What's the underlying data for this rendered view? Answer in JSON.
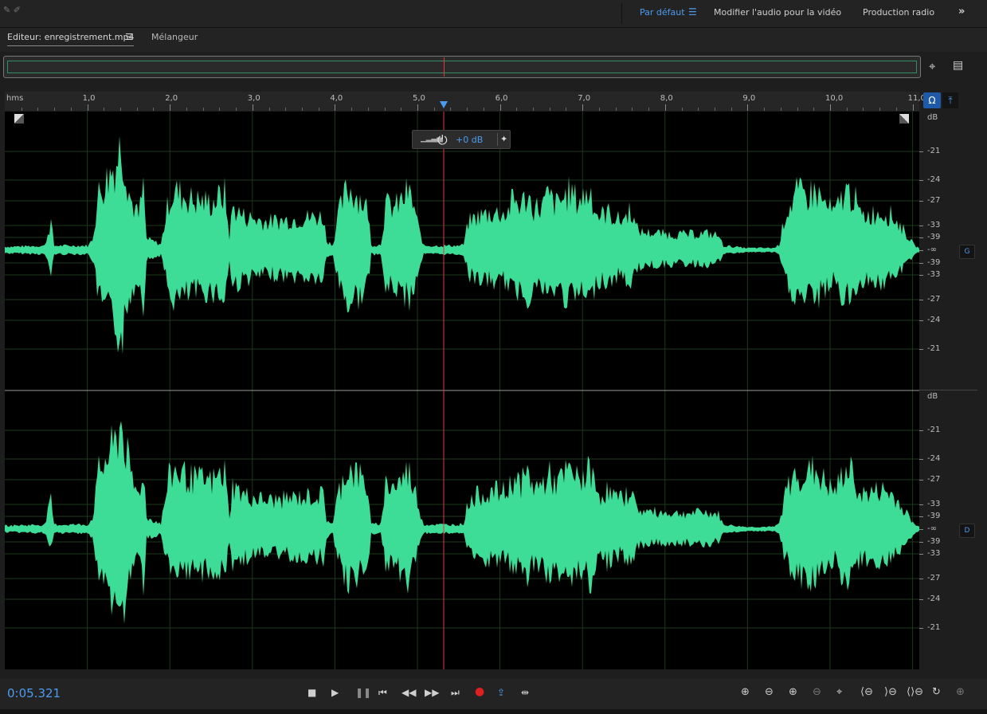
{
  "workspaces": {
    "default": "Par défaut",
    "video": "Modifier l'audio pour la vidéo",
    "radio": "Production radio"
  },
  "editor": {
    "tab_label": "Editeur: enregistrement.mp4",
    "mixer_label": "Mélangeur"
  },
  "ruler": {
    "unit": "hms",
    "ticks": [
      "1,0",
      "2,0",
      "3,0",
      "4,0",
      "5,0",
      "6,0",
      "7,0",
      "8,0",
      "9,0",
      "10,0",
      "11,0"
    ]
  },
  "gain_hud": {
    "value": "+0 dB"
  },
  "channels": {
    "left": "G",
    "right": "D"
  },
  "db_scale": {
    "header": "dB",
    "labels": [
      "-21",
      "-24",
      "-27",
      "-33",
      "-39",
      "-∞",
      "-39",
      "-33",
      "-27",
      "-24",
      "-21"
    ]
  },
  "transport": {
    "timecode": "0:05.321"
  },
  "colors": {
    "waveform": "#3ddc97",
    "accent": "#4b9cf0",
    "playhead": "#e03a3a",
    "record": "#e02020"
  },
  "icons": {
    "workspace_menu": "menu-icon",
    "overflow": "double-chevron-right-icon",
    "zoom": "zoom-icon"
  }
}
